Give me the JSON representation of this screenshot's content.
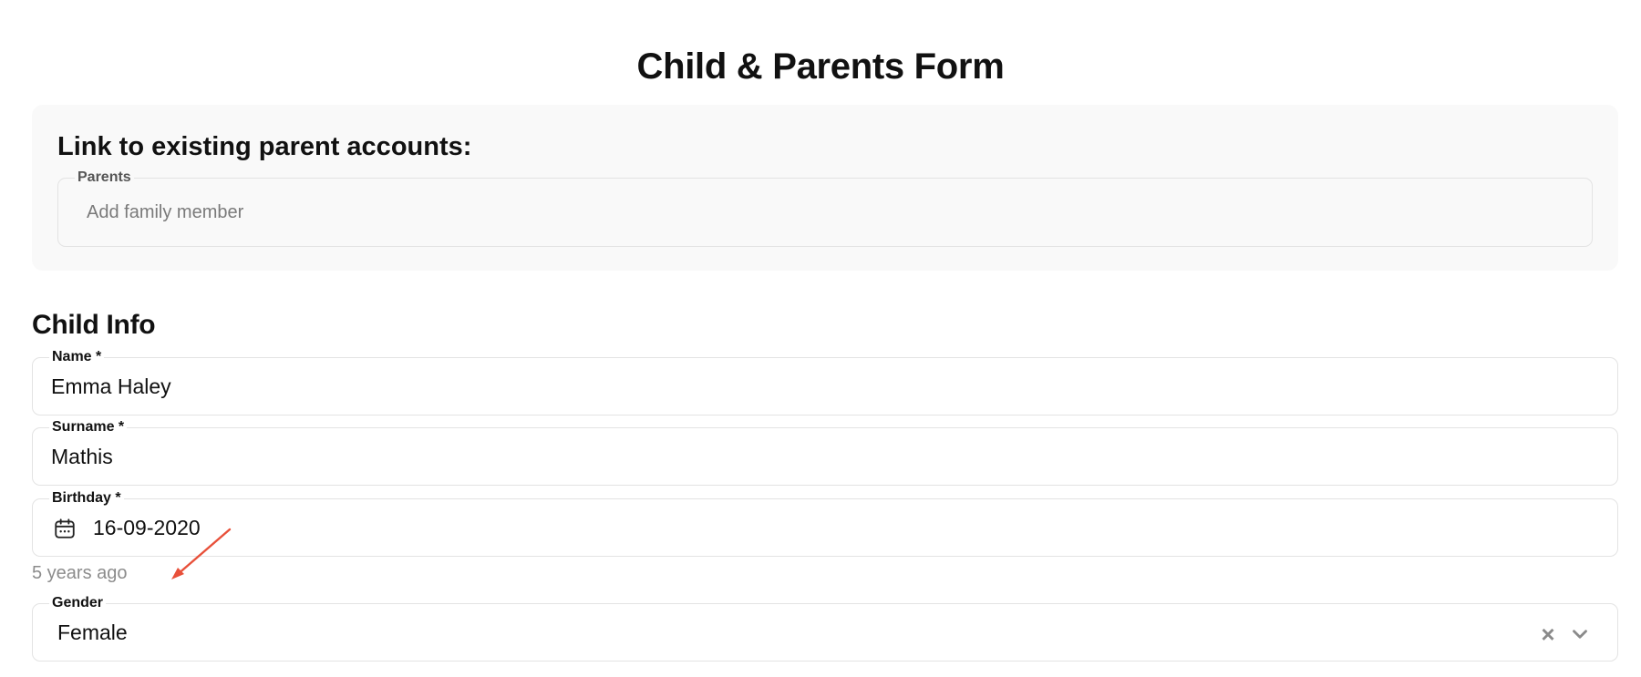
{
  "page": {
    "title": "Child & Parents Form"
  },
  "link_parents": {
    "heading": "Link to existing parent accounts:",
    "parents_field": {
      "label": "Parents",
      "placeholder": "Add family member"
    }
  },
  "child_info": {
    "heading": "Child Info",
    "name": {
      "label": "Name *",
      "value": "Emma Haley"
    },
    "surname": {
      "label": "Surname *",
      "value": "Mathis"
    },
    "birthday": {
      "label": "Birthday *",
      "value": "16-09-2020",
      "helper": "5 years ago",
      "icon": "calendar-icon"
    },
    "gender": {
      "label": "Gender",
      "value": "Female",
      "clear_icon": "×",
      "dropdown_icon": "chevron-down-icon"
    }
  },
  "colors": {
    "annotation_arrow": "#e8503a",
    "helper_text": "#8c8c8c",
    "border": "#e3e3e3"
  }
}
